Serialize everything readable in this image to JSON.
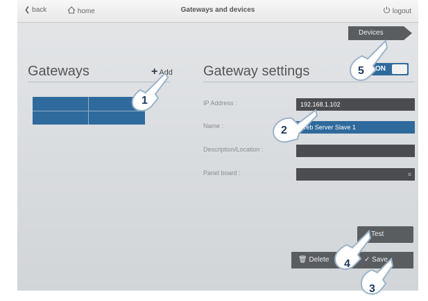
{
  "topbar": {
    "back_label": "back",
    "home_label": "home",
    "title": "Gateways and devices",
    "logout_label": "logout"
  },
  "devices_tab": "Devices",
  "gateways": {
    "title": "Gateways",
    "add_label": "Add"
  },
  "settings": {
    "title": "Gateway settings",
    "toggle_label": "ON",
    "fields": {
      "ip": {
        "label": "IP Address :",
        "value": "192.168.1.102"
      },
      "name": {
        "label": "Name :",
        "value": "Web Server Slave 1"
      },
      "description": {
        "label": "Description/Location :",
        "value": ""
      },
      "panel": {
        "label": "Panel board :",
        "value": ""
      }
    }
  },
  "buttons": {
    "test": "Test",
    "delete": "Delete",
    "save": "Save"
  },
  "callouts": [
    "1",
    "2",
    "3",
    "4",
    "5"
  ],
  "colors": {
    "accent_blue": "#2f6a9c",
    "field_dark": "#4a4c4f",
    "button_dark": "#5a5d60"
  }
}
